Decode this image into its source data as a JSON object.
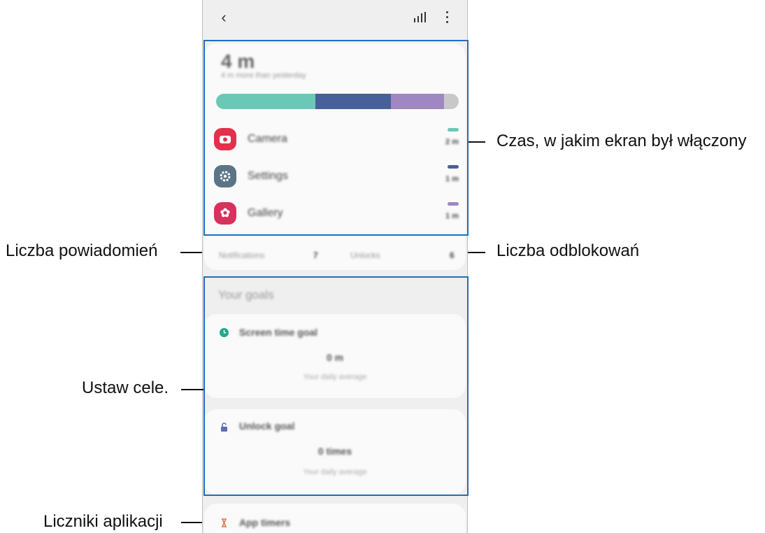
{
  "app": {
    "back_icon": "‹",
    "signal_icon": "chart-bars-icon",
    "more_icon": "more-vertical-icon"
  },
  "usage": {
    "total": "4 m",
    "comparison": "4 m more than yesterday",
    "bar": [
      {
        "color": "#6cc8b6",
        "fraction": 0.41
      },
      {
        "color": "#48609a",
        "fraction": 0.31
      },
      {
        "color": "#9f87c2",
        "fraction": 0.22
      },
      {
        "color": "#c8c8c8",
        "fraction": 0.06
      }
    ],
    "apps": [
      {
        "name": "Camera",
        "time": "2 m",
        "color": "#e4304c",
        "dash": "#6cc8b6",
        "icon": "camera-icon"
      },
      {
        "name": "Settings",
        "time": "1 m",
        "color": "#5a7488",
        "dash": "#48609a",
        "icon": "gear-icon"
      },
      {
        "name": "Gallery",
        "time": "1 m",
        "color": "#d6325c",
        "dash": "#9f87c2",
        "icon": "flower-icon"
      }
    ]
  },
  "stats": {
    "notifications_label": "Notifications",
    "notifications_value": "7",
    "unlocks_label": "Unlocks",
    "unlocks_value": "6"
  },
  "goals": {
    "heading": "Your goals",
    "screen_time": {
      "title": "Screen time goal",
      "value": "0 m",
      "sub": "Your daily average"
    },
    "unlock": {
      "title": "Unlock goal",
      "value": "0 times",
      "sub": "Your daily average"
    }
  },
  "timers": {
    "title": "App timers"
  },
  "callouts": {
    "screen_time": "Czas, w jakim ekran był włączony",
    "notifications": "Liczba powiadomień",
    "unlocks": "Liczba odblokowań",
    "goals": "Ustaw cele.",
    "timers": "Liczniki aplikacji"
  },
  "colors": {
    "highlight": "#1f6fbf",
    "goal_clock": "#22aa88",
    "goal_lock": "#5b6fb0",
    "timer": "#e07b4a"
  }
}
